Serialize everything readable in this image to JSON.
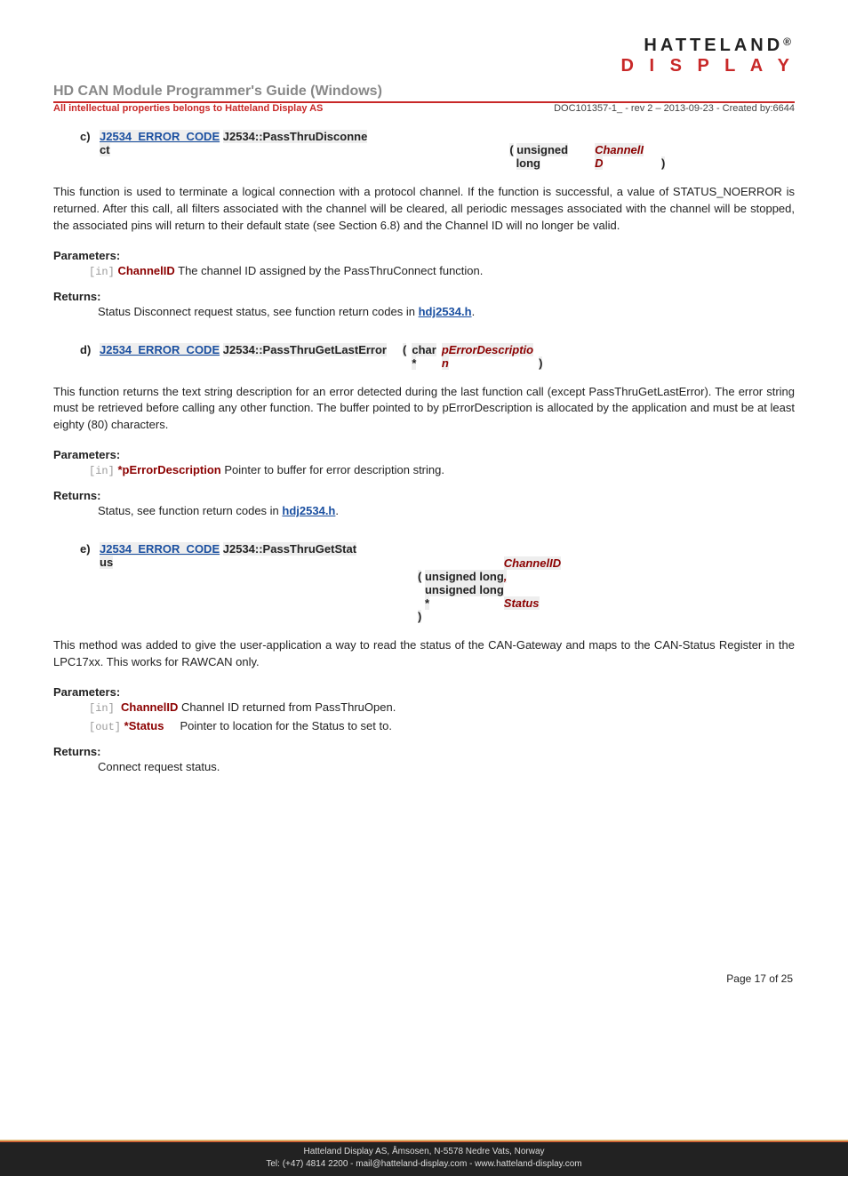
{
  "logo": {
    "top": "HATTELAND",
    "reg": "®",
    "bot": "D I S P L A Y"
  },
  "header": {
    "title": "HD CAN Module Programmer's Guide (Windows)",
    "ip": "All intellectual properties  belongs to Hatteland Display AS",
    "docmeta": "DOC101357-1_ - rev 2 – 2013-09-23 - Created by:6644"
  },
  "sections": {
    "c": {
      "letter": "c)",
      "errcode": "J2534_ERROR_CODE",
      "fname1": "J2534::PassThruDisconne",
      "fname2": "ct",
      "open": "(",
      "ptype1": "unsigned",
      "ptype2": "long",
      "pname1": "ChannelI",
      "pname2": "D",
      "close": ")",
      "para": "This function is used to terminate a logical connection with a protocol channel. If the function is successful, a value of STATUS_NOERROR is returned. After this call, all filters associated with the channel will be cleared, all periodic messages associated with the channel will be stopped, the associated pins will return to their default state (see Section 6.8) and the Channel ID will no longer be valid.",
      "params_label": "Parameters:",
      "p1_dir": "[in]",
      "p1_name": "ChannelID",
      "p1_desc": "The channel ID assigned by the PassThruConnect function.",
      "returns_label": "Returns:",
      "returns_text": "Status Disconnect request status, see function return codes in ",
      "returns_link": "hdj2534.h",
      "returns_dot": "."
    },
    "d": {
      "letter": "d)",
      "errcode": "J2534_ERROR_CODE",
      "fname": "J2534::PassThruGetLastError",
      "open": "(",
      "ptype1": "char",
      "ptype2": "*",
      "pname1": "pErrorDescriptio",
      "pname2": "n",
      "close": ")",
      "para": "This function returns the text string description for an error detected during the last function call (except PassThruGetLastError). The error string must be retrieved before calling any other function. The buffer pointed to by pErrorDescription is allocated by the application and must be at least eighty (80) characters.",
      "params_label": "Parameters:",
      "p1_dir": "[in]",
      "p1_name": "*pErrorDescription",
      "p1_desc": "Pointer to buffer for error description string.",
      "returns_label": "Returns:",
      "returns_text": "Status, see function return codes in ",
      "returns_link": "hdj2534.h",
      "returns_dot": "."
    },
    "e": {
      "letter": "e)",
      "errcode": "J2534_ERROR_CODE",
      "fname1": "J2534::PassThruGetStat",
      "fname2": "us",
      "open": "(",
      "ptype_a": "unsigned long",
      "pname_a": "ChannelID",
      "comma": ",",
      "ptype_b1": "unsigned long",
      "ptype_b2": "*",
      "pname_b": "Status",
      "close": ")",
      "para": "This method was added to give the user-application a way to read the status of the CAN-Gateway and maps to the CAN-Status Register in the LPC17xx. This works for RAWCAN only.",
      "params_label": "Parameters:",
      "p1_dir": "[in]",
      "p1_name": "ChannelID",
      "p1_desc": "Channel ID returned from PassThruOpen.",
      "p2_dir": "[out]",
      "p2_name": "*Status",
      "p2_desc": "Pointer to location for the Status to set to.",
      "returns_label": "Returns:",
      "returns_text": "Connect request status."
    }
  },
  "footer": {
    "pagenum": "Page 17 of 25",
    "line1": "Hatteland Display AS, Åmsosen, N-5578 Nedre Vats, Norway",
    "line2": "Tel: (+47) 4814 2200 - mail@hatteland-display.com - www.hatteland-display.com"
  }
}
